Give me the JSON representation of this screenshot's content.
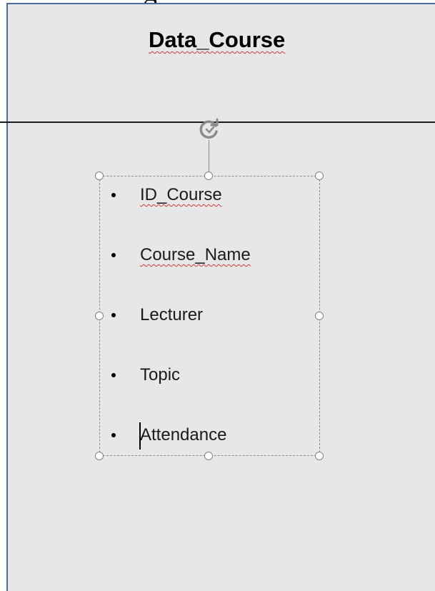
{
  "slide": {
    "title": "Data_Course",
    "list": [
      {
        "label": "ID_Course",
        "spell_error": true
      },
      {
        "label": "Course_Name",
        "spell_error": true
      },
      {
        "label": "Lecturer",
        "spell_error": false
      },
      {
        "label": "Topic",
        "spell_error": false
      },
      {
        "label": "Attendance",
        "spell_error": false
      }
    ]
  },
  "icons": {
    "rotate": "rotate-handle-icon",
    "resize": "resize-handle-icon"
  },
  "colors": {
    "slide_background": "#e7e7e7",
    "slide_border": "#4c6a9c",
    "spellcheck_underline": "#d23a3a",
    "selection_frame": "#8c8c8c"
  }
}
